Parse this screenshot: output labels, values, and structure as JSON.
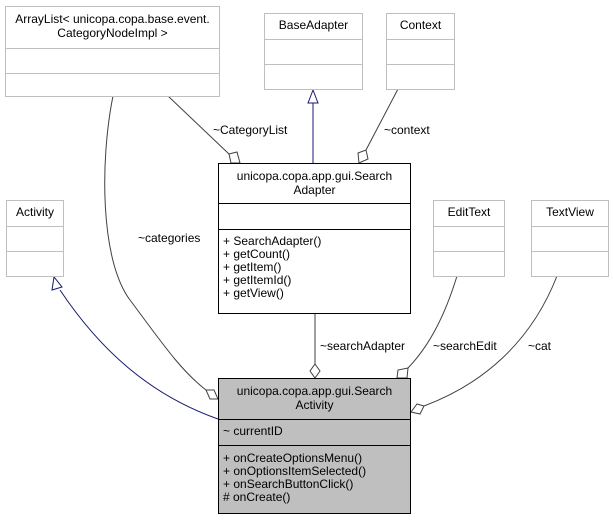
{
  "classes": {
    "arraylist": {
      "title_line1": "ArrayList< unicopa.copa.base.event.",
      "title_line2": "CategoryNodeImpl >",
      "attributes": [],
      "methods": []
    },
    "baseadapter": {
      "title": "BaseAdapter",
      "attributes": [],
      "methods": []
    },
    "context": {
      "title": "Context",
      "attributes": [],
      "methods": []
    },
    "activity": {
      "title": "Activity",
      "attributes": [],
      "methods": []
    },
    "searchadapter": {
      "title_line1": "unicopa.copa.app.gui.Search",
      "title_line2": "Adapter",
      "attributes": [],
      "methods": [
        "+ SearchAdapter()",
        "+ getCount()",
        "+ getItem()",
        "+ getItemId()",
        "+ getView()"
      ]
    },
    "edittext": {
      "title": "EditText",
      "attributes": [],
      "methods": []
    },
    "textview": {
      "title": "TextView",
      "attributes": [],
      "methods": []
    },
    "searchactivity": {
      "title_line1": "unicopa.copa.app.gui.Search",
      "title_line2": "Activity",
      "attributes": [
        "~ currentID"
      ],
      "methods": [
        "+ onCreateOptionsMenu()",
        "+ onOptionsItemSelected()",
        "+ onSearchButtonClick()",
        "# onCreate()"
      ]
    }
  },
  "edge_labels": {
    "category_list": "~CategoryList",
    "context": "~context",
    "categories": "~categories",
    "search_adapter": "~searchAdapter",
    "search_edit": "~searchEdit",
    "cat": "~cat"
  },
  "colors": {
    "inheritance": "#191970",
    "association": "#404040",
    "external_border": "#bfbfbf",
    "focus_fill": "#bfbfbf"
  }
}
